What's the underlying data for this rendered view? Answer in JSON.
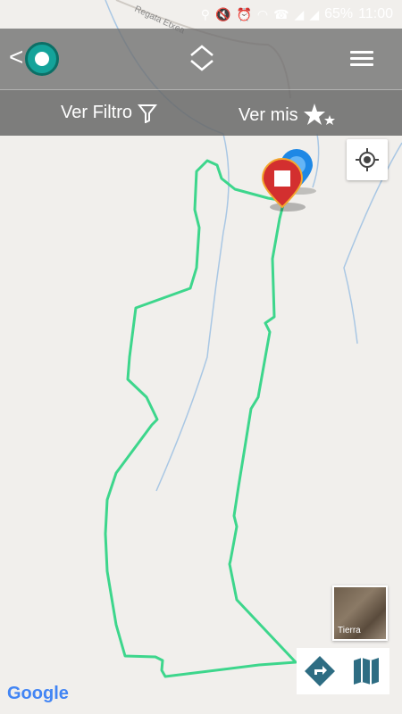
{
  "status_bar": {
    "battery": "65%",
    "time": "11:00"
  },
  "map": {
    "road_label": "Regata Etxea"
  },
  "filter_bar": {
    "left_label": "Ver Filtro",
    "right_label": "Ver mis"
  },
  "layer_toggle": {
    "label": "Tierra"
  },
  "attribution": "Google",
  "colors": {
    "route": "#3dd68c",
    "stream": "#a9c7e4",
    "marker_red": "#d32f2f",
    "marker_blue": "#1e88e5"
  }
}
